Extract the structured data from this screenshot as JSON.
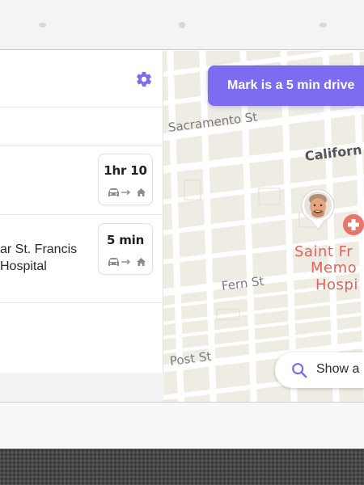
{
  "settings_icon": "gear-icon",
  "accent_color": "#7b6cf0",
  "routes": [
    {
      "destination": "",
      "eta": "1hr 10",
      "mode_icons": [
        "car-icon",
        "arrow-right-icon",
        "home-icon"
      ]
    },
    {
      "destination": "ar St. Francis\nHospital",
      "eta": "5 min",
      "mode_icons": [
        "car-icon",
        "arrow-right-icon",
        "home-icon"
      ]
    }
  ],
  "map": {
    "banner": "Mark is a 5 min drive",
    "streets": [
      "Sacramento St",
      "Californ",
      "Fern St",
      "Post St"
    ],
    "poi_name": [
      "Saint Fr",
      "Memo",
      "Hospi"
    ],
    "poi_color": "#e0645d",
    "avatar_icon": "person-avatar-pin",
    "show_all_label": "Show a",
    "show_all_icon": "search-icon"
  }
}
